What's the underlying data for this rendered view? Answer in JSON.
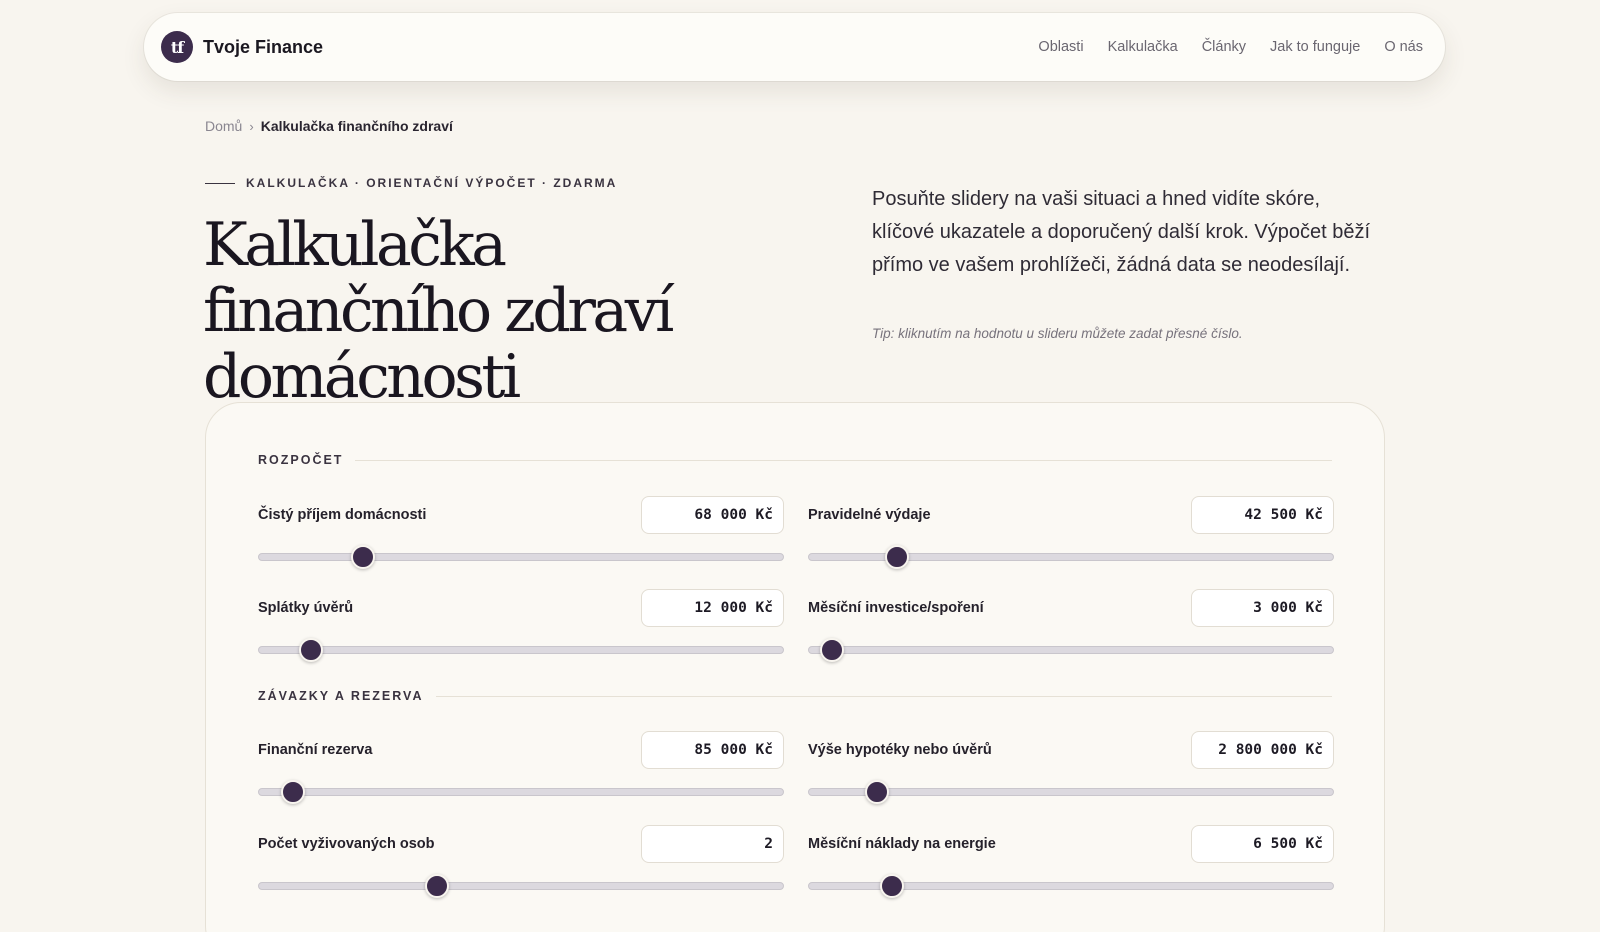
{
  "nav": {
    "logo_text": "tf",
    "brand": "Tvoje Finance",
    "links": [
      "Oblasti",
      "Kalkulačka",
      "Články",
      "Jak to funguje",
      "O nás"
    ]
  },
  "breadcrumb": {
    "home": "Domů",
    "separator": "›",
    "current": "Kalkulačka finančního zdraví"
  },
  "hero": {
    "eyebrow": "KALKULAČKA · ORIENTAČNÍ VÝPOČET · ZDARMA",
    "title": "Kalkulačka finančního zdraví domácnosti",
    "description": "Posuňte slidery na vaši situaci a hned vidíte skóre, klíčové ukazatele a doporučený další krok. Výpočet běží přímo ve vašem prohlížeči, žádná data se neodesílají.",
    "tip": "Tip: kliknutím na hodnotu u slideru můžete zadat přesné číslo."
  },
  "sections": [
    {
      "label": "ROZPOČET",
      "fields": [
        {
          "label": "Čistý příjem domácnosti",
          "value": "68 000 Kč",
          "level": 0.2
        },
        {
          "label": "Pravidelné výdaje",
          "value": "42 500 Kč",
          "level": 0.17
        },
        {
          "label": "Splátky úvěrů",
          "value": "12 000 Kč",
          "level": 0.1
        },
        {
          "label": "Měsíční investice/spoření",
          "value": "3 000 Kč",
          "level": 0.045
        }
      ]
    },
    {
      "label": "ZÁVAZKY A REZERVA",
      "fields": [
        {
          "label": "Finanční rezerva",
          "value": "85 000 Kč",
          "level": 0.066
        },
        {
          "label": "Výše hypotéky nebo úvěrů",
          "value": "2 800 000 Kč",
          "level": 0.131
        },
        {
          "label": "Počet vyživovaných osob",
          "value": "2",
          "level": 0.341
        },
        {
          "label": "Měsíční náklady na energie",
          "value": "6 500 Kč",
          "level": 0.16
        }
      ]
    }
  ],
  "colors": {
    "background": "#f8f5ef",
    "accent": "#3c2c4c",
    "track": "#dcd9df"
  }
}
